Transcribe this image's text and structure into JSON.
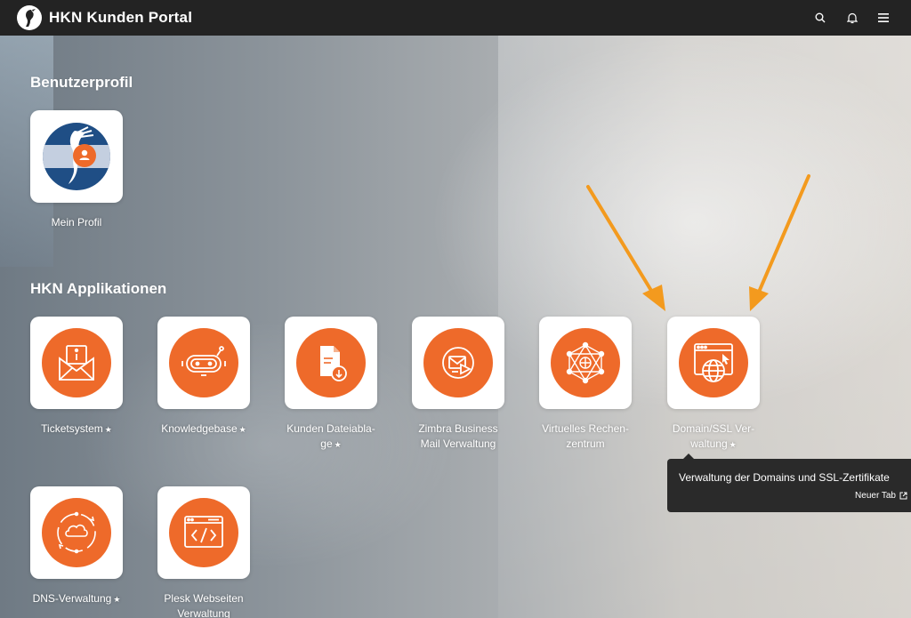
{
  "header": {
    "title": "HKN Kunden Portal",
    "icons": [
      "search-icon",
      "bell-icon",
      "menu-icon"
    ]
  },
  "sections": {
    "profile": {
      "title": "Benutzerprofil"
    },
    "apps": {
      "title": "HKN Applikationen"
    }
  },
  "profile_tile": {
    "label": "Mein Profil",
    "icon": "user-icon"
  },
  "apps": [
    {
      "line1": "Ticketsystem",
      "line2": "",
      "star": "★",
      "icon": "ticket-mail-icon"
    },
    {
      "line1": "Knowledgebase",
      "line2": "",
      "star": "★",
      "icon": "robot-icon"
    },
    {
      "line1": "Kunden Dateiabla-",
      "line2": "ge",
      "star": "★",
      "icon": "file-download-icon"
    },
    {
      "line1": "Zimbra Business",
      "line2": "Mail Verwaltung",
      "star": "",
      "icon": "mail-send-icon"
    },
    {
      "line1": "Virtuelles Rechen-",
      "line2": "zentrum",
      "star": "",
      "icon": "network-globe-icon"
    },
    {
      "line1": "Domain/SSL Ver-",
      "line2": "waltung",
      "star": "★",
      "icon": "browser-globe-icon"
    },
    {
      "line1": "DNS-Verwaltung",
      "line2": "",
      "star": "★",
      "icon": "cloud-sync-icon"
    },
    {
      "line1": "Plesk Webseiten",
      "line2": "Verwaltung",
      "star": "",
      "icon": "code-window-icon"
    }
  ],
  "tooltip": {
    "text": "Verwaltung der Domains und SSL-Zertifikate",
    "link": "Neuer Tab"
  },
  "colors": {
    "accent": "#ee6a2a",
    "topbar": "#232323",
    "arrow": "#f39a1e"
  }
}
